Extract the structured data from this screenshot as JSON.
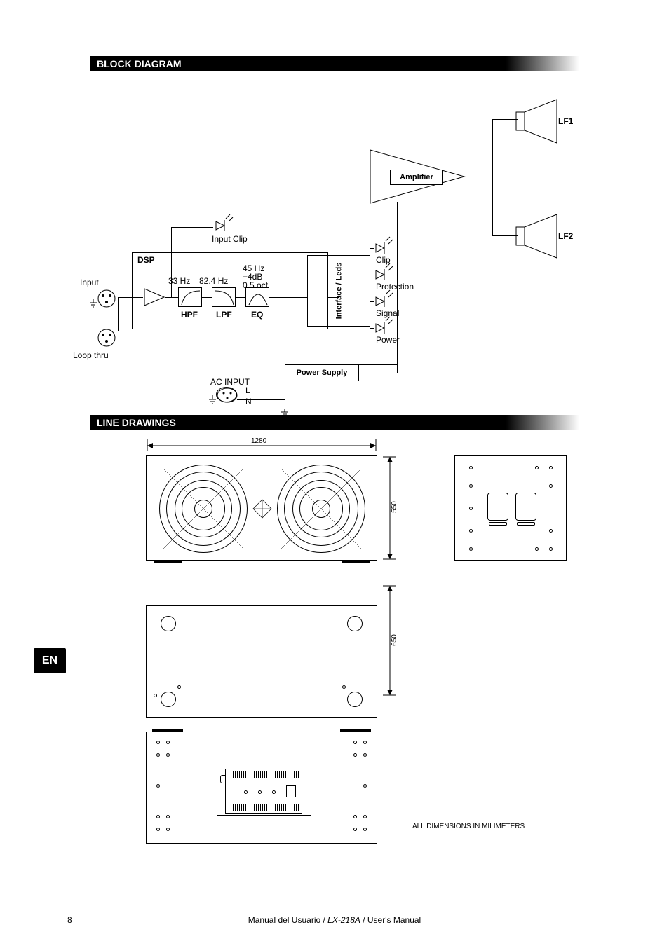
{
  "lang_tab": "EN",
  "sections": {
    "block_diagram": "BLOCK DIAGRAM",
    "line_drawings": "LINE DRAWINGS"
  },
  "block_diagram": {
    "input": "Input",
    "loop_thru": "Loop thru",
    "input_clip": "Input  Clip",
    "dsp": "DSP",
    "hpf": "HPF",
    "lpf": "LPF",
    "eq": "EQ",
    "hpf_freq": "33 Hz",
    "lpf_freq": "82.4 Hz",
    "eq_freq": "45 Hz",
    "eq_gain": "+4dB",
    "eq_q": "0.5 oct",
    "interface_leds": "Interface / Leds",
    "led_clip": "Clip",
    "led_protection": "Protection",
    "led_signal": "Signal",
    "led_power": "Power",
    "amplifier": "Amplifier",
    "lf1": "LF1",
    "lf2": "LF2",
    "power_supply": "Power Supply",
    "ac_input": "AC  INPUT",
    "ac_l": "L",
    "ac_n": "N"
  },
  "line_drawings": {
    "width": "1280",
    "height": "550",
    "depth": "650",
    "note": "ALL  DIMENSIONS  IN  MILIMETERS"
  },
  "footer": {
    "page": "8",
    "left": "Manual  del  Usuario  /",
    "model": "LX-218A",
    "right": "/  User's Manual"
  }
}
